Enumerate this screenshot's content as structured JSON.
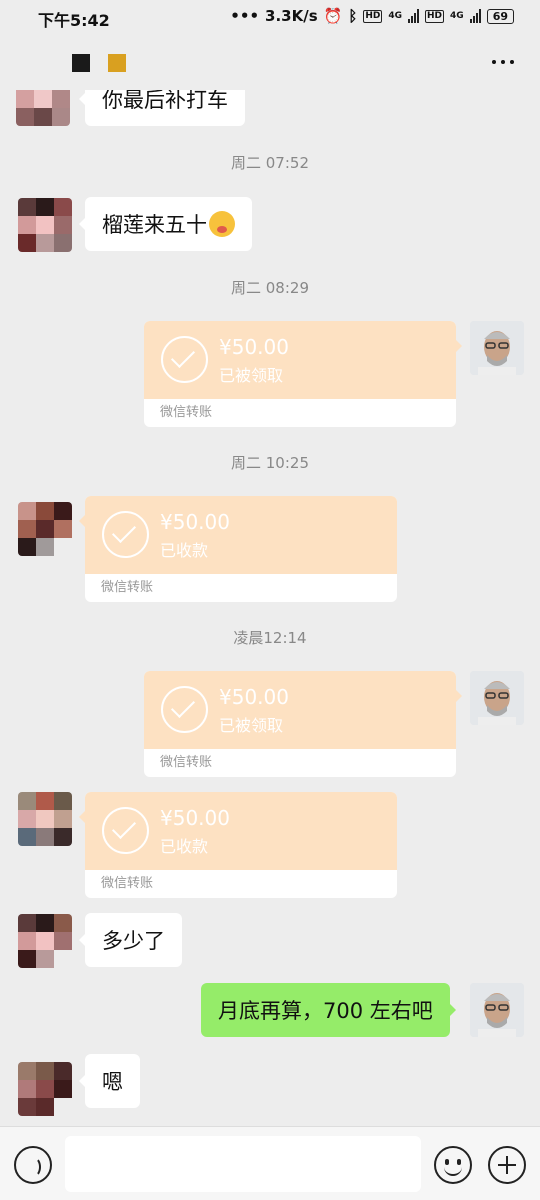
{
  "status_bar": {
    "time": "下午5:42",
    "net_speed": "3.3K/s",
    "signal_label_1": "4G",
    "signal_label_2": "4G",
    "hd_1": "HD",
    "hd_2": "HD",
    "battery": "69"
  },
  "header": {
    "more_icon": "more-horizontal-icon"
  },
  "messages": {
    "partial_text": "你最后补打车",
    "ts1": "周二 07:52",
    "msg1": "榴莲来五十",
    "ts2": "周二 08:29",
    "transfer1": {
      "amount": "¥50.00",
      "status": "已被领取",
      "label": "微信转账"
    },
    "ts3": "周二 10:25",
    "transfer2": {
      "amount": "¥50.00",
      "status": "已收款",
      "label": "微信转账"
    },
    "ts4": "凌晨12:14",
    "transfer3": {
      "amount": "¥50.00",
      "status": "已被领取",
      "label": "微信转账"
    },
    "transfer4": {
      "amount": "¥50.00",
      "status": "已收款",
      "label": "微信转账"
    },
    "msg2": "多少了",
    "msg3": "月底再算，700 左右吧",
    "msg4": "嗯"
  },
  "input_bar": {
    "placeholder": ""
  },
  "colors": {
    "accent_green": "#95ec69",
    "transfer_orange": "#fde1c2",
    "background": "#ededed"
  }
}
